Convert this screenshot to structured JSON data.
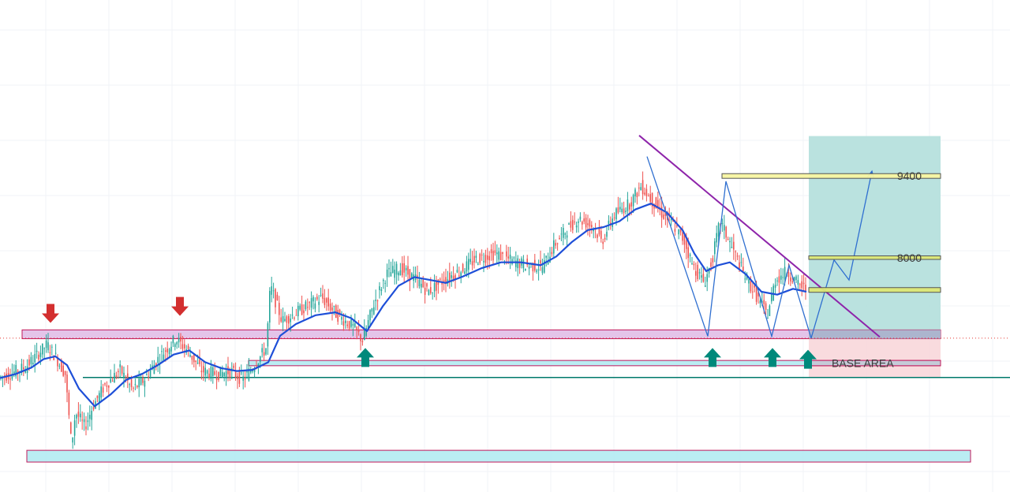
{
  "chart_data": {
    "type": "candlestick",
    "title": "",
    "xlabel": "",
    "ylabel": "",
    "ylim": [
      4000,
      11000
    ],
    "grid": true,
    "colors": {
      "up": "#26a69a",
      "down": "#ef5350",
      "moving_average": "#1e4fd8",
      "trendline": "#8e24aa",
      "projection": "#2f6fd0",
      "support_line": "#00796b",
      "resistance_zone": "#e1bee7",
      "base_zone": "#b2ebf2",
      "bottom_zone": "#b2ebf2",
      "target_zone": "#b2dfdb",
      "stop_zone": "#f8d7da",
      "level_box": "#dce775",
      "down_arrow": "#d32f2f",
      "up_arrow": "#00897b"
    },
    "price_path": [
      [
        0,
        5980
      ],
      [
        15,
        6050
      ],
      [
        35,
        6170
      ],
      [
        50,
        6380
      ],
      [
        62,
        6550
      ],
      [
        72,
        6360
      ],
      [
        85,
        6050
      ],
      [
        93,
        4830
      ],
      [
        98,
        5400
      ],
      [
        110,
        5150
      ],
      [
        120,
        5500
      ],
      [
        135,
        5850
      ],
      [
        155,
        6120
      ],
      [
        170,
        5780
      ],
      [
        185,
        5950
      ],
      [
        205,
        6350
      ],
      [
        225,
        6650
      ],
      [
        240,
        6450
      ],
      [
        258,
        6100
      ],
      [
        278,
        6050
      ],
      [
        295,
        6100
      ],
      [
        310,
        5950
      ],
      [
        325,
        6200
      ],
      [
        340,
        6500
      ],
      [
        345,
        7550
      ],
      [
        360,
        6950
      ],
      [
        385,
        7150
      ],
      [
        410,
        7350
      ],
      [
        430,
        7050
      ],
      [
        450,
        6850
      ],
      [
        462,
        6620
      ],
      [
        475,
        7200
      ],
      [
        492,
        7750
      ],
      [
        510,
        7850
      ],
      [
        530,
        7650
      ],
      [
        545,
        7450
      ],
      [
        565,
        7650
      ],
      [
        585,
        7800
      ],
      [
        605,
        8000
      ],
      [
        630,
        8100
      ],
      [
        650,
        7980
      ],
      [
        670,
        7900
      ],
      [
        690,
        7870
      ],
      [
        705,
        8250
      ],
      [
        720,
        8500
      ],
      [
        735,
        8700
      ],
      [
        755,
        8550
      ],
      [
        765,
        8300
      ],
      [
        780,
        8750
      ],
      [
        800,
        8950
      ],
      [
        815,
        9250
      ],
      [
        826,
        9050
      ],
      [
        840,
        8800
      ],
      [
        855,
        8600
      ],
      [
        870,
        8300
      ],
      [
        880,
        7900
      ],
      [
        895,
        7600
      ],
      [
        905,
        8000
      ],
      [
        915,
        8650
      ],
      [
        930,
        8200
      ],
      [
        945,
        7750
      ],
      [
        960,
        7400
      ],
      [
        975,
        7050
      ],
      [
        985,
        7650
      ],
      [
        1000,
        7800
      ],
      [
        1012,
        7600
      ],
      [
        1022,
        7500
      ]
    ],
    "moving_average_path": [
      [
        0,
        5980
      ],
      [
        20,
        6050
      ],
      [
        40,
        6160
      ],
      [
        55,
        6300
      ],
      [
        70,
        6350
      ],
      [
        85,
        6200
      ],
      [
        100,
        5800
      ],
      [
        120,
        5500
      ],
      [
        140,
        5700
      ],
      [
        160,
        5950
      ],
      [
        180,
        6050
      ],
      [
        200,
        6200
      ],
      [
        220,
        6380
      ],
      [
        240,
        6450
      ],
      [
        260,
        6250
      ],
      [
        280,
        6150
      ],
      [
        300,
        6100
      ],
      [
        320,
        6120
      ],
      [
        340,
        6250
      ],
      [
        355,
        6700
      ],
      [
        375,
        6900
      ],
      [
        400,
        7050
      ],
      [
        425,
        7100
      ],
      [
        445,
        7000
      ],
      [
        465,
        6780
      ],
      [
        485,
        7200
      ],
      [
        505,
        7550
      ],
      [
        525,
        7700
      ],
      [
        545,
        7650
      ],
      [
        565,
        7600
      ],
      [
        585,
        7700
      ],
      [
        610,
        7850
      ],
      [
        635,
        7950
      ],
      [
        660,
        7950
      ],
      [
        685,
        7900
      ],
      [
        705,
        8050
      ],
      [
        725,
        8300
      ],
      [
        745,
        8500
      ],
      [
        765,
        8550
      ],
      [
        785,
        8650
      ],
      [
        805,
        8850
      ],
      [
        825,
        8950
      ],
      [
        845,
        8800
      ],
      [
        865,
        8500
      ],
      [
        880,
        8100
      ],
      [
        895,
        7800
      ],
      [
        910,
        7900
      ],
      [
        925,
        7950
      ],
      [
        945,
        7750
      ],
      [
        965,
        7450
      ],
      [
        985,
        7400
      ],
      [
        1005,
        7500
      ],
      [
        1022,
        7450
      ]
    ],
    "candle_spacing": 2.4,
    "zones": [
      {
        "name": "resistance-zone",
        "y": [
          6650,
          6800
        ],
        "x": [
          28,
          1192
        ],
        "label": ""
      },
      {
        "name": "base-area-zone",
        "y": [
          6190,
          6280
        ],
        "x": [
          315,
          1192
        ],
        "label": "BASE AREA"
      },
      {
        "name": "bottom-zone",
        "y": [
          4550,
          4750
        ],
        "x": [
          34,
          1230
        ],
        "label": ""
      },
      {
        "name": "target-zone",
        "y": [
          6650,
          10100
        ],
        "x": [
          1025,
          1192
        ],
        "label": ""
      },
      {
        "name": "stop-zone",
        "y": [
          5990,
          6650
        ],
        "x": [
          1025,
          1192
        ],
        "label": ""
      }
    ],
    "levels": [
      {
        "name": "level-9400",
        "y": [
          9380,
          9460
        ],
        "x": [
          915,
          1192
        ],
        "label": "9400",
        "fill": "#f7f4a1"
      },
      {
        "name": "level-8000",
        "y": [
          8000,
          8060
        ],
        "x": [
          1025,
          1192
        ],
        "label": "8000",
        "fill": "#dce775"
      },
      {
        "name": "level-7400",
        "y": [
          7440,
          7520
        ],
        "x": [
          1025,
          1192
        ],
        "label": "",
        "fill": "#dce775"
      }
    ],
    "trendlines": [
      {
        "name": "descending-trendline",
        "from": [
          810,
          10110
        ],
        "to": [
          1115,
          6680
        ]
      }
    ],
    "horizontal_lines": [
      {
        "name": "support-line",
        "y": 5990,
        "x": [
          105,
          1280
        ],
        "style": "solid"
      },
      {
        "name": "zone-dotted-line",
        "y": 6660,
        "x": [
          0,
          1280
        ],
        "style": "dotted"
      }
    ],
    "pattern_lines": [
      {
        "name": "zigzag-pattern",
        "points": [
          [
            820,
            9750
          ],
          [
            897,
            6690
          ],
          [
            920,
            9330
          ],
          [
            978,
            6690
          ],
          [
            1000,
            7900
          ],
          [
            1028,
            6660
          ]
        ]
      },
      {
        "name": "projection-path",
        "points": [
          [
            1028,
            6660
          ],
          [
            1057,
            7990
          ],
          [
            1076,
            7650
          ],
          [
            1105,
            9500
          ]
        ]
      }
    ],
    "markers": [
      {
        "name": "down-arrow-1",
        "x": 64,
        "y": 7080,
        "dir": "down"
      },
      {
        "name": "down-arrow-2",
        "x": 228,
        "y": 7200,
        "dir": "down"
      },
      {
        "name": "up-arrow-1",
        "x": 463,
        "y": 6330,
        "dir": "up"
      },
      {
        "name": "up-arrow-2",
        "x": 903,
        "y": 6330,
        "dir": "up"
      },
      {
        "name": "up-arrow-3",
        "x": 979,
        "y": 6330,
        "dir": "up"
      },
      {
        "name": "up-arrow-4",
        "x": 1024,
        "y": 6300,
        "dir": "up"
      }
    ]
  }
}
